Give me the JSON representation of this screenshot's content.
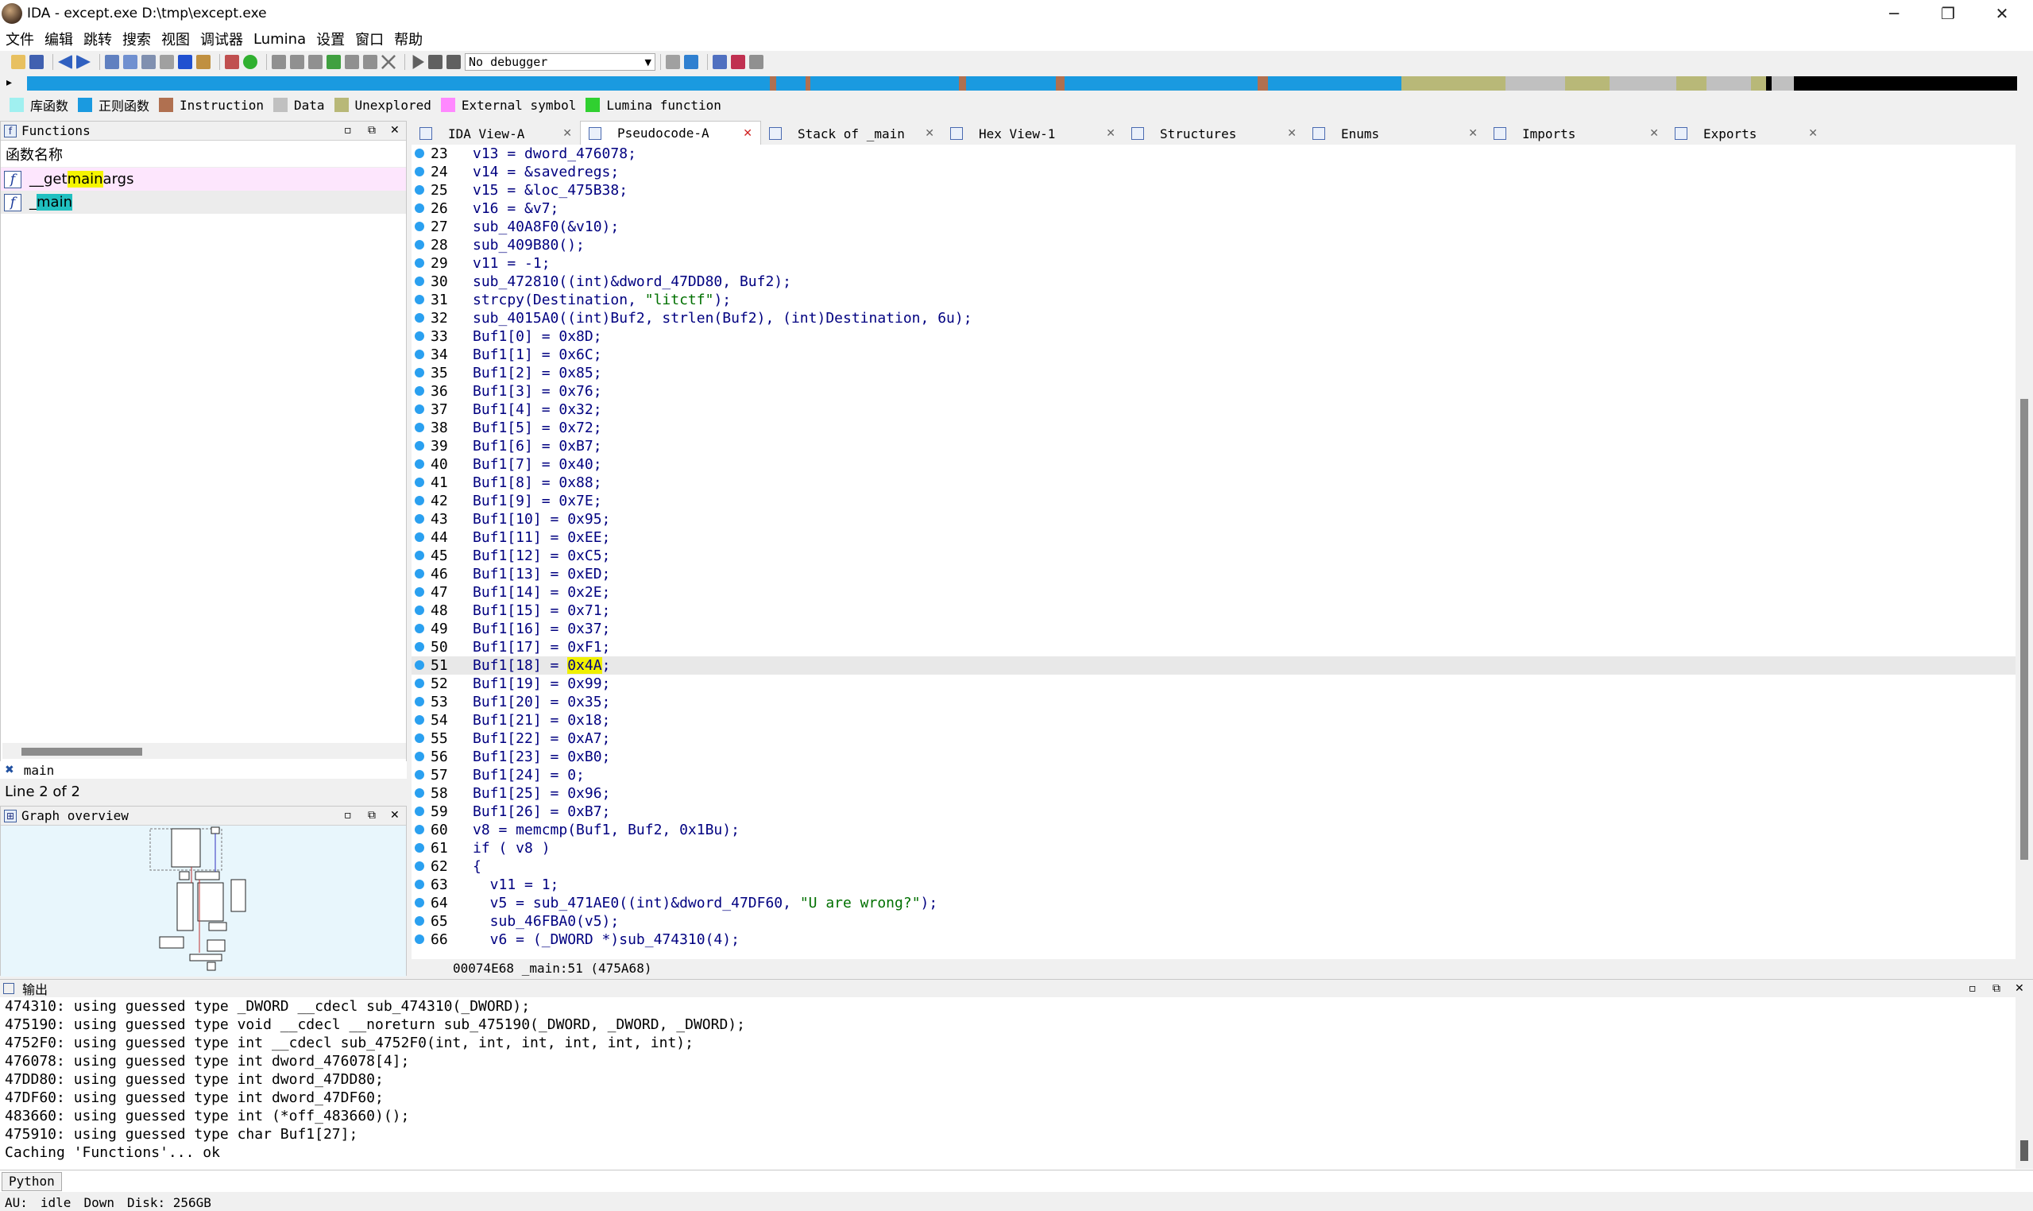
{
  "window": {
    "title": "IDA - except.exe D:\\tmp\\except.exe",
    "minimize": "─",
    "maximize": "❐",
    "close": "✕"
  },
  "menu": [
    "文件",
    "编辑",
    "跳转",
    "搜索",
    "视图",
    "调试器",
    "Lumina",
    "设置",
    "窗口",
    "帮助"
  ],
  "toolbar": {
    "debugger": "No debugger"
  },
  "legend": [
    {
      "label": "库函数",
      "color": "#a0f0f0"
    },
    {
      "label": "正则函数",
      "color": "#1a9ae0"
    },
    {
      "label": "Instruction",
      "color": "#b07050"
    },
    {
      "label": "Data",
      "color": "#c0c0c0"
    },
    {
      "label": "Unexplored",
      "color": "#b8b878"
    },
    {
      "label": "External symbol",
      "color": "#ff88ff"
    },
    {
      "label": "Lumina function",
      "color": "#30d030"
    }
  ],
  "functions": {
    "title": "Functions",
    "column": "函数名称",
    "items": [
      {
        "pre": "__get",
        "hl": "main",
        "post": "args"
      },
      {
        "pre": "_",
        "hl": "main",
        "post": ""
      }
    ],
    "filter": "main",
    "line_count": "Line 2 of 2"
  },
  "graph": {
    "title": "Graph overview"
  },
  "tabs": [
    {
      "label": "IDA View-A"
    },
    {
      "label": "Pseudocode-A"
    },
    {
      "label": "Stack of _main"
    },
    {
      "label": "Hex View-1"
    },
    {
      "label": "Structures"
    },
    {
      "label": "Enums"
    },
    {
      "label": "Imports"
    },
    {
      "label": "Exports"
    }
  ],
  "code": [
    {
      "n": "23",
      "t": "v13 = dword_476078;"
    },
    {
      "n": "24",
      "t": "v14 = &savedregs;"
    },
    {
      "n": "25",
      "t": "v15 = &loc_475B38;"
    },
    {
      "n": "26",
      "t": "v16 = &v7;"
    },
    {
      "n": "27",
      "t": "sub_40A8F0(&v10);"
    },
    {
      "n": "28",
      "t": "sub_409B80();"
    },
    {
      "n": "29",
      "t": "v11 = -1;"
    },
    {
      "n": "30",
      "t": "sub_472810((int)&dword_47DD80, Buf2);"
    },
    {
      "n": "31",
      "t": "strcpy(Destination, \"litctf\");"
    },
    {
      "n": "32",
      "t": "sub_4015A0((int)Buf2, strlen(Buf2), (int)Destination, 6u);"
    },
    {
      "n": "33",
      "t": "Buf1[0] = 0x8D;"
    },
    {
      "n": "34",
      "t": "Buf1[1] = 0x6C;"
    },
    {
      "n": "35",
      "t": "Buf1[2] = 0x85;"
    },
    {
      "n": "36",
      "t": "Buf1[3] = 0x76;"
    },
    {
      "n": "37",
      "t": "Buf1[4] = 0x32;"
    },
    {
      "n": "38",
      "t": "Buf1[5] = 0x72;"
    },
    {
      "n": "39",
      "t": "Buf1[6] = 0xB7;"
    },
    {
      "n": "40",
      "t": "Buf1[7] = 0x40;"
    },
    {
      "n": "41",
      "t": "Buf1[8] = 0x88;"
    },
    {
      "n": "42",
      "t": "Buf1[9] = 0x7E;"
    },
    {
      "n": "43",
      "t": "Buf1[10] = 0x95;"
    },
    {
      "n": "44",
      "t": "Buf1[11] = 0xEE;"
    },
    {
      "n": "45",
      "t": "Buf1[12] = 0xC5;"
    },
    {
      "n": "46",
      "t": "Buf1[13] = 0xED;"
    },
    {
      "n": "47",
      "t": "Buf1[14] = 0x2E;"
    },
    {
      "n": "48",
      "t": "Buf1[15] = 0x71;"
    },
    {
      "n": "49",
      "t": "Buf1[16] = 0x37;"
    },
    {
      "n": "50",
      "t": "Buf1[17] = 0xF1;"
    },
    {
      "n": "51",
      "t": "Buf1[18] = 0x4A;"
    },
    {
      "n": "52",
      "t": "Buf1[19] = 0x99;"
    },
    {
      "n": "53",
      "t": "Buf1[20] = 0x35;"
    },
    {
      "n": "54",
      "t": "Buf1[21] = 0x18;"
    },
    {
      "n": "55",
      "t": "Buf1[22] = 0xA7;"
    },
    {
      "n": "56",
      "t": "Buf1[23] = 0xB0;"
    },
    {
      "n": "57",
      "t": "Buf1[24] = 0;"
    },
    {
      "n": "58",
      "t": "Buf1[25] = 0x96;"
    },
    {
      "n": "59",
      "t": "Buf1[26] = 0xB7;"
    },
    {
      "n": "60",
      "t": "v8 = memcmp(Buf1, Buf2, 0x1Bu);"
    },
    {
      "n": "61",
      "t": "if ( v8 )"
    },
    {
      "n": "62",
      "t": "{"
    },
    {
      "n": "63",
      "t": "  v11 = 1;"
    },
    {
      "n": "64",
      "t": "  v5 = sub_471AE0((int)&dword_47DF60, \"U are wrong?\");"
    },
    {
      "n": "65",
      "t": "  sub_46FBA0(v5);"
    },
    {
      "n": "66",
      "t": "  v6 = (_DWORD *)sub_474310(4);"
    }
  ],
  "code_status": "00074E68 _main:51 (475A68)",
  "output": {
    "title": "输出",
    "lines": [
      "474310: using guessed type _DWORD __cdecl sub_474310(_DWORD);",
      "475190: using guessed type void __cdecl __noreturn sub_475190(_DWORD, _DWORD, _DWORD);",
      "4752F0: using guessed type int __cdecl sub_4752F0(int, int, int, int, int, int);",
      "476078: using guessed type int dword_476078[4];",
      "47DD80: using guessed type int dword_47DD80;",
      "47DF60: using guessed type int dword_47DF60;",
      "483660: using guessed type int (*off_483660)();",
      "475910: using guessed type char Buf1[27];",
      "Caching 'Functions'... ok"
    ]
  },
  "python_button": "Python",
  "status": {
    "au": "AU:",
    "state": "idle",
    "dir": "Down",
    "disk": "Disk: 256GB"
  }
}
